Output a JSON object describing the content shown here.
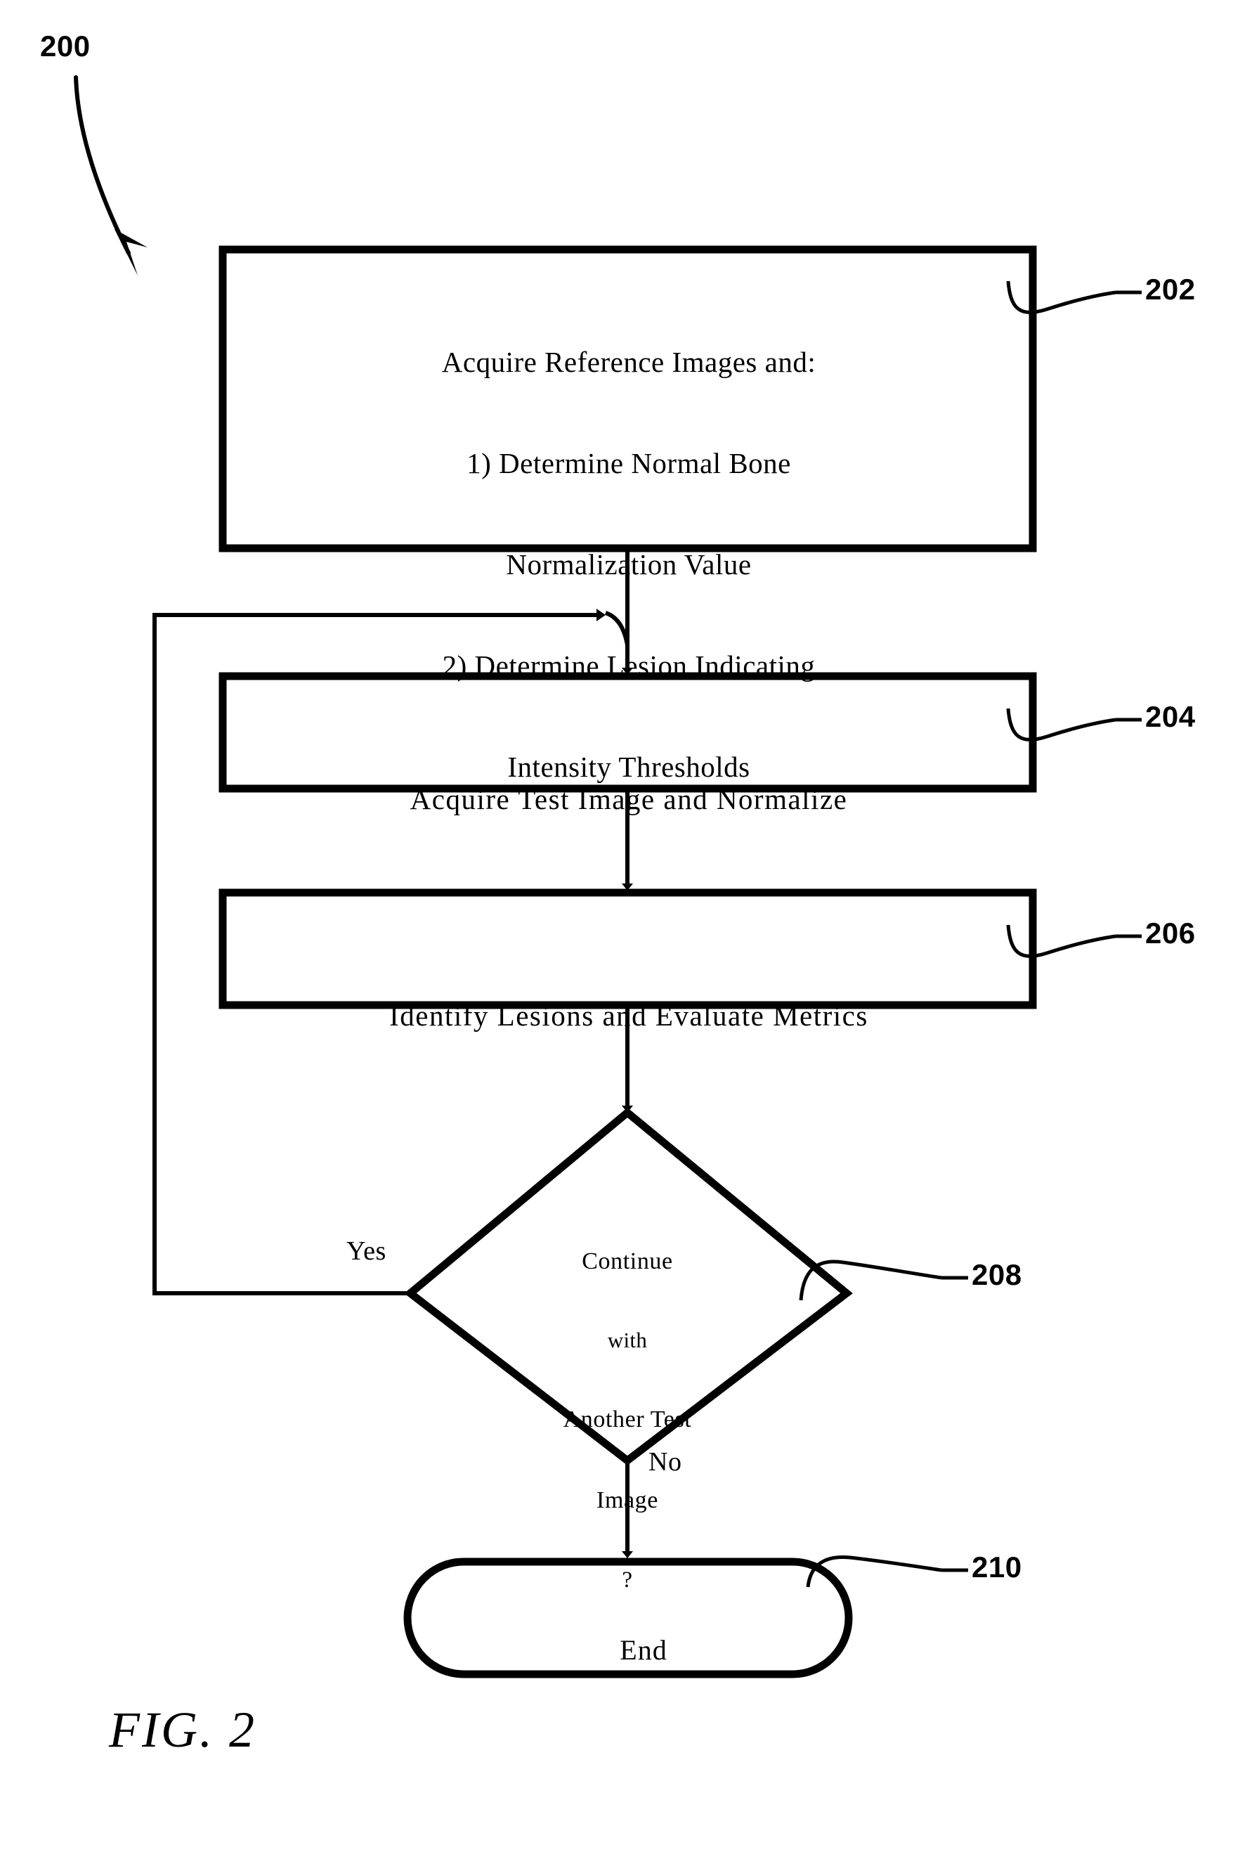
{
  "figure": {
    "caption": "FIG. 2",
    "diagram_ref": "200"
  },
  "chart_data": {
    "type": "diagram",
    "subtype": "flowchart",
    "title": "FIG. 2",
    "diagram_ref": "200",
    "nodes": [
      {
        "id": "202",
        "ref": "202",
        "shape": "rectangle",
        "lines": [
          "Acquire Reference Images and:",
          "1) Determine Normal Bone",
          "Normalization Value",
          "2) Determine Lesion Indicating",
          "Intensity Thresholds"
        ]
      },
      {
        "id": "204",
        "ref": "204",
        "shape": "rectangle",
        "lines": [
          "Acquire Test Image and Normalize"
        ]
      },
      {
        "id": "206",
        "ref": "206",
        "shape": "rectangle",
        "lines": [
          "Identify Lesions and Evaluate Metrics"
        ]
      },
      {
        "id": "208",
        "ref": "208",
        "shape": "diamond",
        "lines": [
          "Continue",
          "with",
          "Another Test",
          "Image",
          "?"
        ]
      },
      {
        "id": "210",
        "ref": "210",
        "shape": "stadium",
        "lines": [
          "End"
        ]
      }
    ],
    "edges": [
      {
        "from": "202",
        "to": "204",
        "label": ""
      },
      {
        "from": "204",
        "to": "206",
        "label": ""
      },
      {
        "from": "206",
        "to": "208",
        "label": ""
      },
      {
        "from": "208",
        "to": "204",
        "label": "Yes"
      },
      {
        "from": "208",
        "to": "210",
        "label": "No"
      }
    ]
  },
  "boxes": {
    "b202": {
      "l1": "Acquire Reference Images and:",
      "l2": "1) Determine Normal Bone",
      "l3": "Normalization Value",
      "l4": "2) Determine Lesion Indicating",
      "l5": "Intensity Thresholds"
    },
    "b204": {
      "l1": "Acquire Test Image and Normalize"
    },
    "b206": {
      "l1": "Identify Lesions and Evaluate Metrics"
    },
    "b208": {
      "l1": "Continue",
      "l2": "with",
      "l3": "Another Test",
      "l4": "Image",
      "l5": "?"
    },
    "b210": {
      "l1": "End"
    }
  },
  "labels": {
    "yes": "Yes",
    "no": "No",
    "ref200": "200",
    "ref202": "202",
    "ref204": "204",
    "ref206": "206",
    "ref208": "208",
    "ref210": "210"
  },
  "colors": {
    "ink": "#000000",
    "paper": "#ffffff"
  }
}
